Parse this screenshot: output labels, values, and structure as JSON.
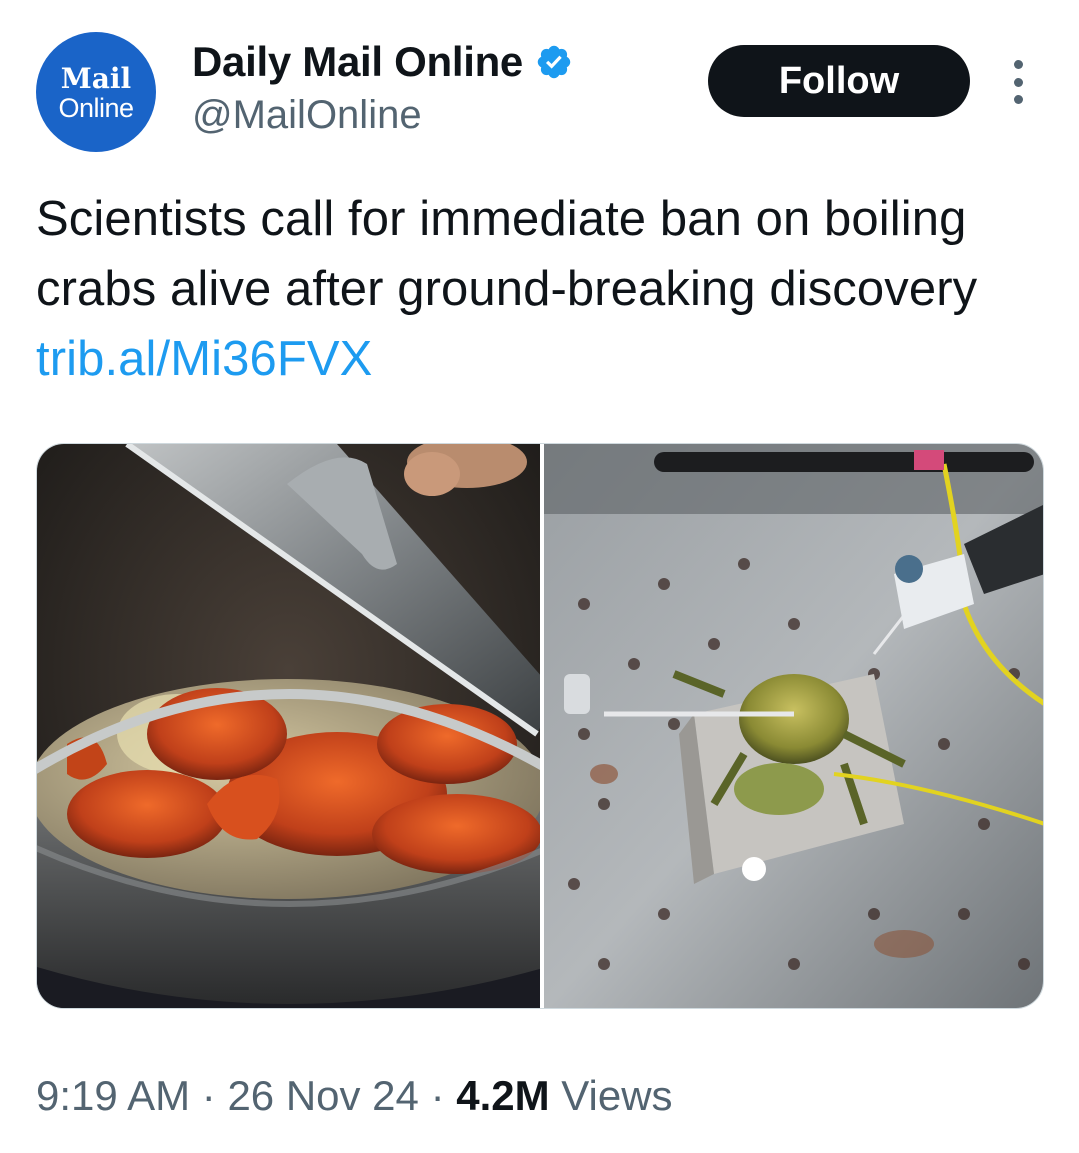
{
  "author": {
    "avatar_line1": "Mail",
    "avatar_line2": "Online",
    "display_name": "Daily Mail Online",
    "handle": "@MailOnline",
    "verified": true
  },
  "actions": {
    "follow_label": "Follow",
    "more_icon": "more-vertical-icon"
  },
  "tweet": {
    "text": "Scientists call for immediate ban on boiling crabs alive after ground-breaking discovery ",
    "link": "trib.al/Mi36FVX"
  },
  "media": {
    "left_image": "crabs-boiling-in-pan-photo",
    "right_image": "crab-on-lab-electrodes-photo"
  },
  "meta": {
    "time": "9:19 AM",
    "sep1": " · ",
    "date": "26 Nov 24",
    "sep2": " · ",
    "views_count": "4.2M",
    "views_label": " Views"
  },
  "colors": {
    "link": "#1d9bf0",
    "verified": "#1d9bf0",
    "avatar_bg": "#1a64c8",
    "button_bg": "#0f1419"
  }
}
